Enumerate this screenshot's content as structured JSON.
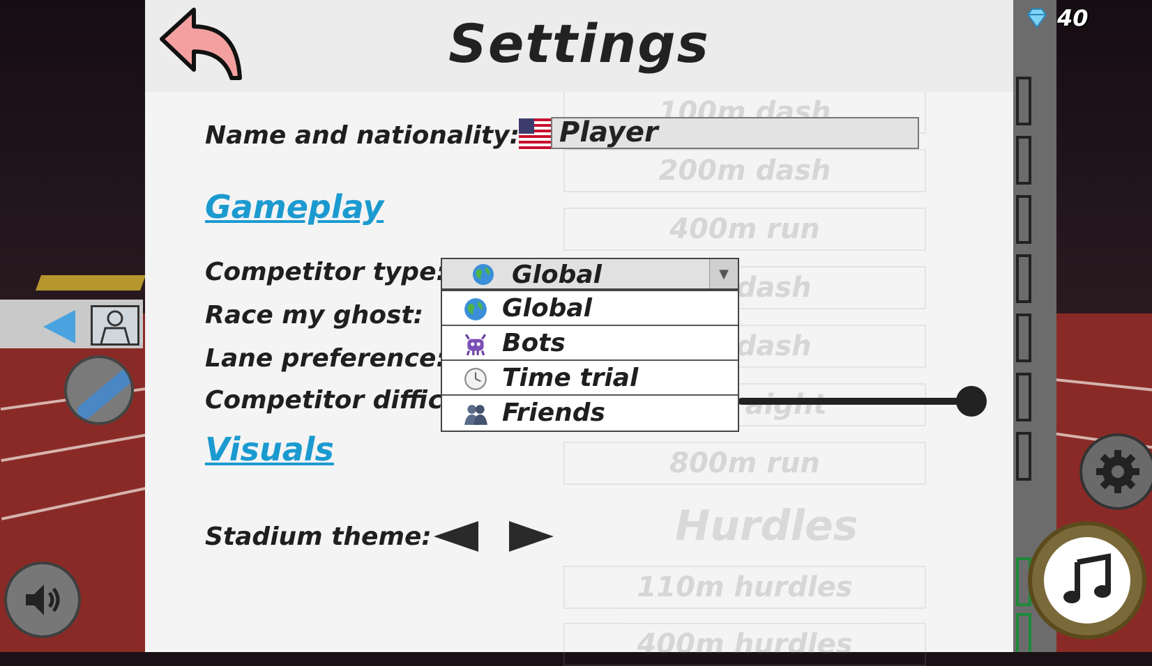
{
  "header": {
    "title": "Settings",
    "back_icon": "back-arrow-icon"
  },
  "profile": {
    "name_label": "Name and nationality:",
    "name_value": "Player",
    "flag_icon": "usa-flag-icon"
  },
  "gameplay": {
    "section_title": "Gameplay",
    "competitor_type_label": "Competitor type:",
    "competitor_type_value": "Global",
    "race_ghost_label": "Race my ghost:",
    "lane_preference_label": "Lane preference:",
    "difficulty_label": "Competitor difficul",
    "dropdown_options": [
      {
        "label": "Global",
        "icon": "globe-icon"
      },
      {
        "label": "Bots",
        "icon": "bot-icon"
      },
      {
        "label": "Time trial",
        "icon": "stopwatch-icon"
      },
      {
        "label": "Friends",
        "icon": "friends-icon"
      }
    ]
  },
  "visuals": {
    "section_title": "Visuals",
    "stadium_theme_label": "Stadium theme:"
  },
  "hud": {
    "gem_count": "40"
  },
  "background_list": {
    "items": [
      "100m dash",
      "200m dash",
      "400m run",
      "0m dash",
      "0m dash",
      "m straight",
      "800m run"
    ],
    "hurdles_title": "Hurdles",
    "hurdle_items": [
      "110m hurdles",
      "400m hurdles"
    ]
  },
  "colors": {
    "section_link": "#1b9ad0",
    "back_arrow": "#f4a0a0",
    "panel_bg": "#f4f4f4"
  }
}
